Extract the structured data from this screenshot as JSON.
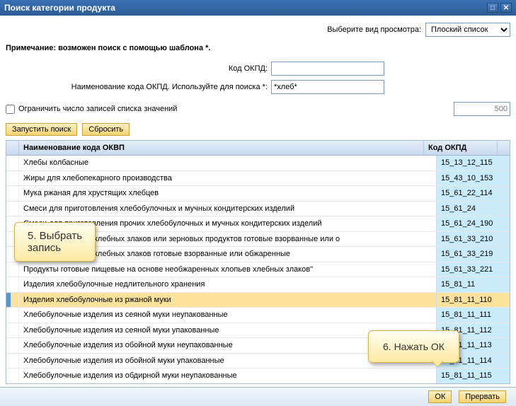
{
  "window": {
    "title": "Поиск категории продукта"
  },
  "viewType": {
    "label": "Выберите вид просмотра:",
    "value": "Плоский список"
  },
  "note": "Примечание: возможен поиск с помощью шаблона *.",
  "fields": {
    "code": {
      "label": "Код ОКПД:",
      "value": ""
    },
    "name": {
      "label": "Наименование кода ОКПД. Используйте для поиска *:",
      "value": "*хлеб*"
    },
    "limitChk": "Ограничить число записей списка значений",
    "limitVal": "500"
  },
  "buttons": {
    "search": "Запустить поиск",
    "reset": "Сбросить",
    "ok": "ОК",
    "cancel": "Прервать"
  },
  "table": {
    "headers": {
      "name": "Наименование кода ОКВП",
      "code": "Код ОКПД"
    },
    "rows": [
      {
        "name": "Хлебы колбасные",
        "code": "15_13_12_115"
      },
      {
        "name": "Жиры для хлебопекарного производства",
        "code": "15_43_10_153"
      },
      {
        "name": "Мука ржаная для хрустящих хлебцев",
        "code": "15_61_22_114"
      },
      {
        "name": "Смеси для приготовления хлебобулочных и мучных кондитерских изделий",
        "code": "15_61_24"
      },
      {
        "name": "Смеси для приготовления прочих хлебобулочных и мучных кондитерских изделий",
        "code": "15_61_24_190"
      },
      {
        "name": "Продукты из зерна хлебных злаков или зерновых продуктов готовые взорванные или о",
        "code": "15_61_33_210"
      },
      {
        "name": "Продукты из зерна хлебных злаков готовые взорванные или обжаренные",
        "code": "15_61_33_219"
      },
      {
        "name": "Продукты готовые пищевые на основе необжаренных хлопьев хлебных злаков\"",
        "code": "15_61_33_221"
      },
      {
        "name": "Изделия хлебобулочные недлительного хранения",
        "code": "15_81_11"
      },
      {
        "name": "Изделия хлебобулочные из ржаной муки",
        "code": "15_81_11_110",
        "selected": true
      },
      {
        "name": "Хлебобулочные изделия из сеяной муки неупакованные",
        "code": "15_81_11_111"
      },
      {
        "name": "Хлебобулочные изделия из сеяной муки упакованные",
        "code": "15_81_11_112"
      },
      {
        "name": "Хлебобулочные изделия из обойной муки неупакованные",
        "code": "15_81_11_113"
      },
      {
        "name": "Хлебобулочные изделия из обойной муки упакованные",
        "code": "15_81_11_114"
      },
      {
        "name": "Хлебобулочные изделия из обдирной муки неупакованные",
        "code": "15_81_11_115"
      }
    ]
  },
  "callouts": {
    "c1_l1": "5. Выбрать",
    "c1_l2": "запись",
    "c2": "6. Нажать ОК"
  }
}
